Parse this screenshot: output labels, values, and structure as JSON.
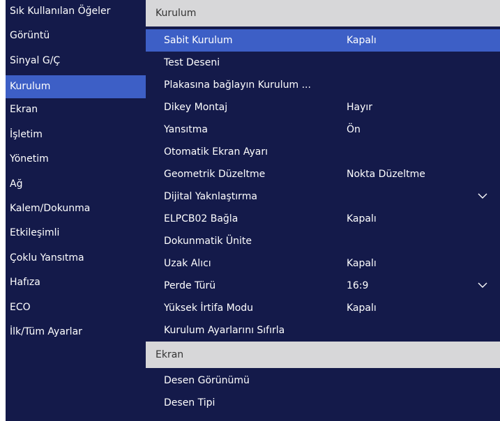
{
  "sidebar": {
    "items": [
      {
        "label": "Sık Kullanılan Öğeler"
      },
      {
        "label": "Görüntü"
      },
      {
        "label": "Sinyal G/Ç"
      },
      {
        "label": "Kurulum"
      },
      {
        "label": "Ekran"
      },
      {
        "label": "İşletim"
      },
      {
        "label": "Yönetim"
      },
      {
        "label": "Ağ"
      },
      {
        "label": "Kalem/Dokunma"
      },
      {
        "label": "Etkileşimli"
      },
      {
        "label": "Çoklu Yansıtma"
      },
      {
        "label": "Hafıza"
      },
      {
        "label": "ECO"
      },
      {
        "label": "İlk/Tüm Ayarlar"
      }
    ],
    "active_index": 3
  },
  "main": {
    "section_kurulum": {
      "title": "Kurulum",
      "rows": [
        {
          "label": "Sabit Kurulum",
          "value": "Kapalı"
        },
        {
          "label": "Test Deseni",
          "value": ""
        },
        {
          "label": "Plakasına bağlayın Kurulum ...",
          "value": ""
        },
        {
          "label": "Dikey Montaj",
          "value": "Hayır"
        },
        {
          "label": "Yansıtma",
          "value": "Ön"
        },
        {
          "label": "Otomatik Ekran Ayarı",
          "value": ""
        },
        {
          "label": "Geometrik Düzeltme",
          "value": "Nokta Düzeltme"
        },
        {
          "label": "Dijital Yaknlaştırma",
          "value": "",
          "icon": "chevron-down-icon"
        },
        {
          "label": "ELPCB02 Bağla",
          "value": "Kapalı"
        },
        {
          "label": "Dokunmatik Ünite",
          "value": ""
        },
        {
          "label": "Uzak Alıcı",
          "value": "Kapalı"
        },
        {
          "label": "Perde Türü",
          "value": "16:9",
          "icon": "chevron-down-icon"
        },
        {
          "label": "Yüksek İrtifa Modu",
          "value": "Kapalı"
        },
        {
          "label": "Kurulum Ayarlarını Sıfırla",
          "value": ""
        }
      ]
    },
    "section_ekran": {
      "title": "Ekran",
      "rows": [
        {
          "label": "Desen Görünümü",
          "value": ""
        },
        {
          "label": "Desen Tipi",
          "value": ""
        }
      ]
    }
  },
  "colors": {
    "background": "#141a4a",
    "selected": "#3d5fc6",
    "section_header": "#d7d7d9",
    "text": "#ffffff"
  }
}
